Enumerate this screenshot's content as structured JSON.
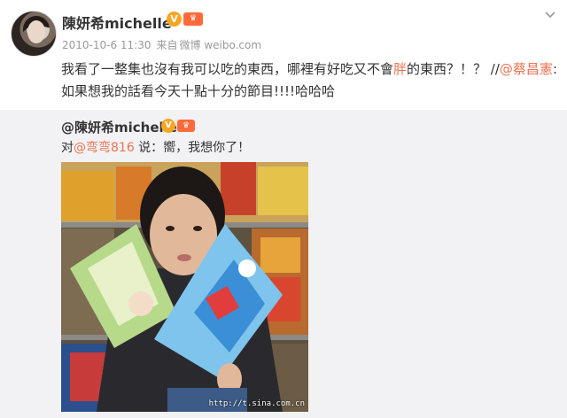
{
  "post": {
    "author": "陳妍希michelle",
    "time": "2010-10-6 11:30",
    "source_prefix": "来自",
    "source": "微博 weibo.com",
    "text_part1": "我看了一整集也沒有我可以吃的東西，哪裡有好吃又不會",
    "text_highlight": "胖",
    "text_part2": "的東西？！？ //",
    "mention": "@蔡昌憲",
    "text_part3": ":如果想我的話看今天十點十分的節目!!!!哈哈哈"
  },
  "repost": {
    "author": "@陳妍希michelle",
    "text_prefix": "对",
    "mention": "@弯弯816",
    "text_suffix": " 说：嚮，我想你了！",
    "watermark": "http://t.sina.com.cn"
  },
  "icons": {
    "verified": "verified-v-icon",
    "vip": "vip-crown-icon",
    "menu": "chevron-down-icon"
  },
  "colors": {
    "accent": "#eb7350",
    "verified": "#f5a623",
    "repost_bg": "#f2f2f5"
  }
}
